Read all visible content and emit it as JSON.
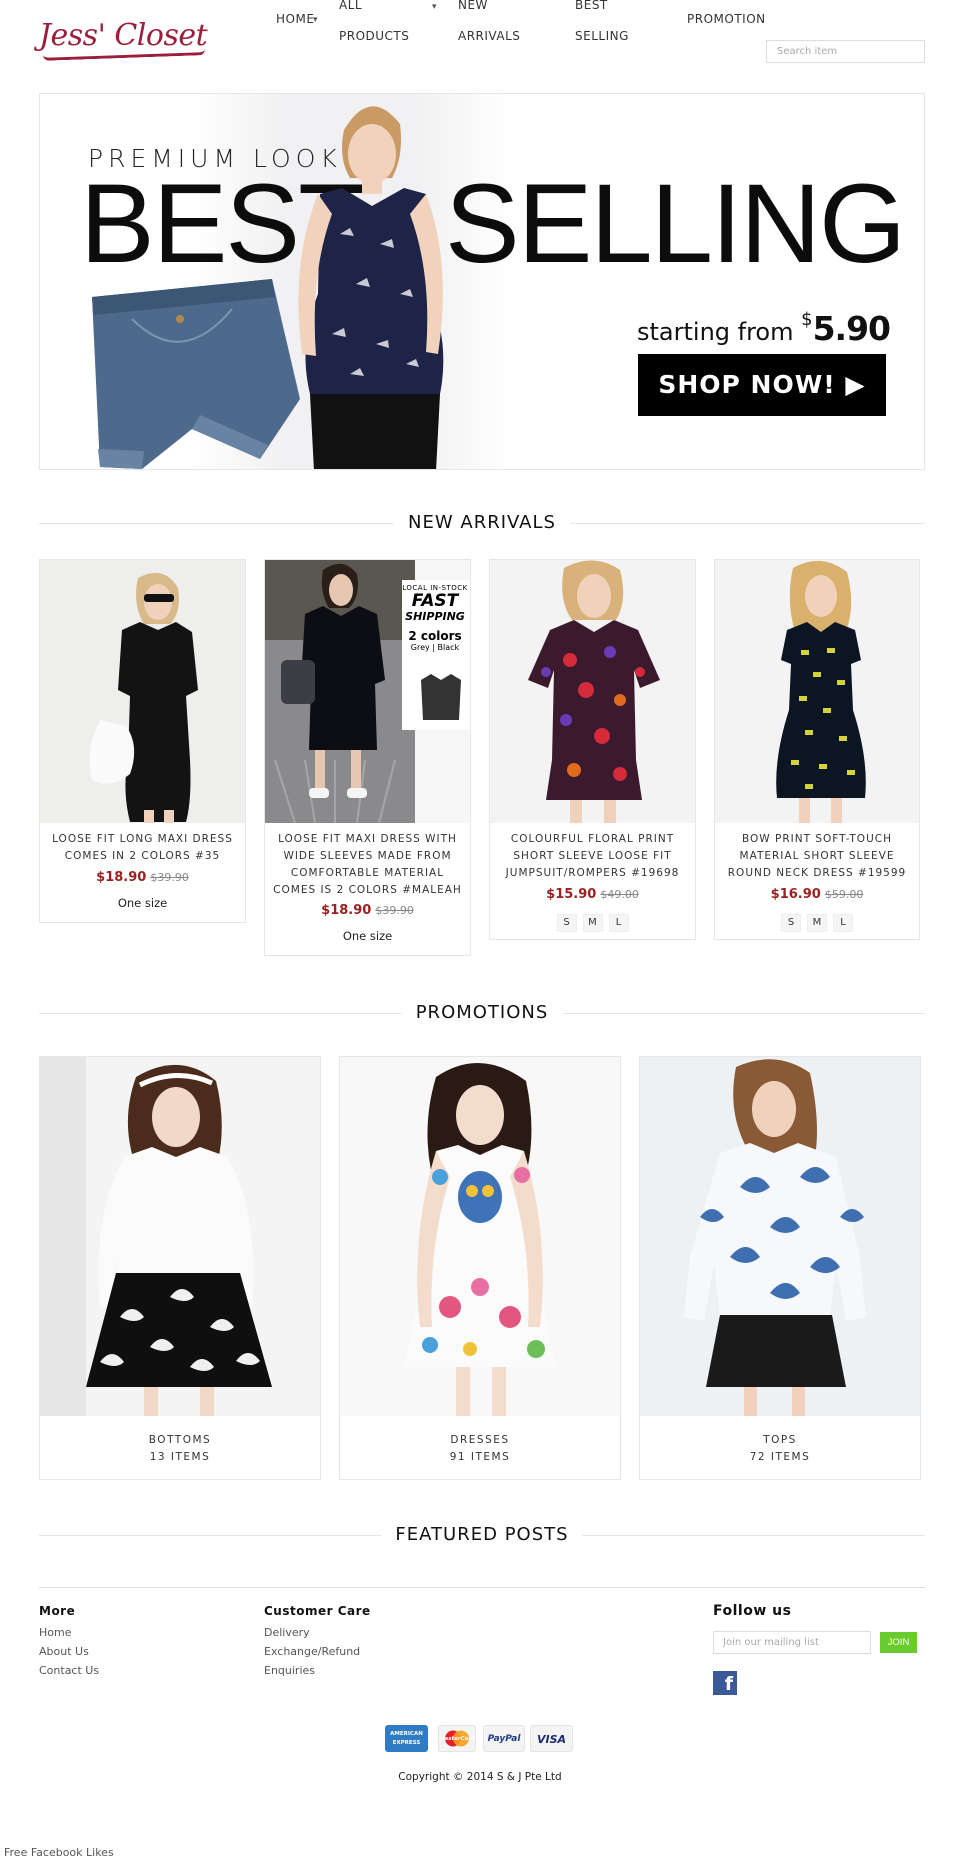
{
  "header": {
    "logo_text": "Jess' Closet",
    "nav": [
      {
        "label": "HOME"
      },
      {
        "label": "ALL"
      },
      {
        "label": "PRODUCTS"
      },
      {
        "label": "NEW"
      },
      {
        "label": "ARRIVALS"
      },
      {
        "label": "BEST"
      },
      {
        "label": "SELLING"
      },
      {
        "label": "PROMOTION"
      }
    ],
    "search_placeholder": "Search item"
  },
  "hero": {
    "kicker": "PREMIUM LOOK",
    "headline_1": "BEST",
    "headline_2": "SELLING",
    "starting_text": "starting from ",
    "currency": "$",
    "price": "5.90",
    "cta": "SHOP NOW! ▶"
  },
  "sections": {
    "new_arrivals": "NEW ARRIVALS",
    "promotions": "PROMOTIONS",
    "featured_posts": "FEATURED POSTS"
  },
  "products": [
    {
      "name": "LOOSE FIT LONG MAXI DRESS COMES IN 2 COLORS #35",
      "price": "$18.90",
      "was": "$39.90",
      "size": "One size"
    },
    {
      "name": "LOOSE FIT MAXI DRESS WITH WIDE SLEEVES MADE FROM COMFORTABLE MATERIAL COMES IS 2 COLORS #MALEAH",
      "price": "$18.90",
      "was": "$39.90",
      "size": "One size",
      "badge": {
        "line1": "LOCAL IN-STOCK",
        "line2": "FAST",
        "line3": "SHIPPING",
        "line4": "2 colors",
        "line5": "Grey | Black"
      }
    },
    {
      "name": "COLOURFUL FLORAL PRINT SHORT SLEEVE LOOSE FIT JUMPSUIT/ROMPERS #19698",
      "price": "$15.90",
      "was": "$49.00",
      "sizes": [
        "S",
        "M",
        "L"
      ]
    },
    {
      "name": "BOW PRINT SOFT-TOUCH MATERIAL SHORT SLEEVE ROUND NECK DRESS #19599",
      "price": "$16.90",
      "was": "$59.00",
      "sizes": [
        "S",
        "M",
        "L"
      ]
    }
  ],
  "promos": [
    {
      "category": "BOTTOMS",
      "count": "13 ITEMS"
    },
    {
      "category": "DRESSES",
      "count": "91 ITEMS"
    },
    {
      "category": "TOPS",
      "count": "72 ITEMS"
    }
  ],
  "footer": {
    "more_heading": "More",
    "more_links": [
      "Home",
      "About Us",
      "Contact Us"
    ],
    "care_heading": "Customer Care",
    "care_links": [
      "Delivery",
      "Exchange/Refund",
      "Enquiries"
    ],
    "follow_heading": "Follow us",
    "mail_placeholder": "Join our mailing list",
    "join_label": "JOIN",
    "facebook_glyph": "f",
    "payments": [
      {
        "label": "AMERICAN EXPRESS",
        "icon": "amex-icon"
      },
      {
        "label": "MasterCard",
        "icon": "mastercard-icon"
      },
      {
        "label": "PayPal",
        "icon": "paypal-icon"
      },
      {
        "label": "VISA",
        "icon": "visa-icon"
      }
    ],
    "copyright": "Copyright © 2014 S & J Pte Ltd",
    "fb_likes": "Free Facebook Likes"
  },
  "colors": {
    "brand": "#9b1f3b",
    "price": "#9b1f1f",
    "join": "#6acb2e",
    "facebook": "#3b5998"
  }
}
